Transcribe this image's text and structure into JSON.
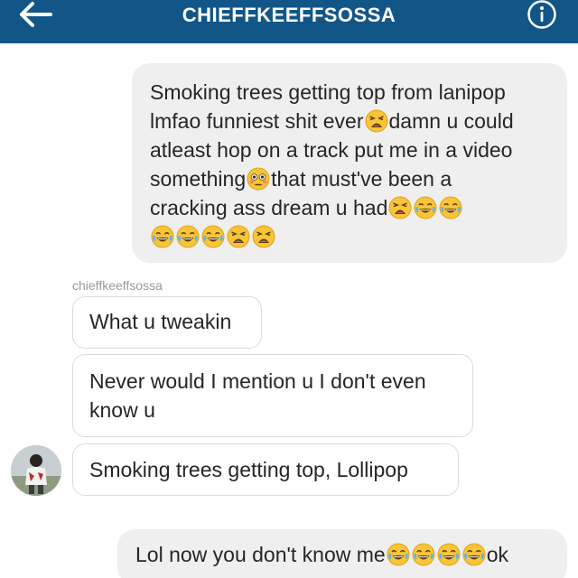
{
  "header": {
    "title": "CHIEFFKEEFFSOSSA",
    "back_icon": "arrow-left-icon",
    "info_icon": "info-icon",
    "background": "#125688"
  },
  "thread": {
    "sender_name": "chieffkeeffsossa",
    "messages": [
      {
        "direction": "outgoing",
        "lines": [
          [
            {
              "t": "text",
              "v": "Smoking trees getting top from lanipop"
            }
          ],
          [
            {
              "t": "text",
              "v": "lmfao funniest shit ever"
            },
            {
              "t": "emoji",
              "v": "weary"
            },
            {
              "t": "text",
              "v": "damn u could"
            }
          ],
          [
            {
              "t": "text",
              "v": "atleast hop on a track put me in a video"
            }
          ],
          [
            {
              "t": "text",
              "v": "something"
            },
            {
              "t": "emoji",
              "v": "flushed"
            },
            {
              "t": "text",
              "v": "that must've been a"
            }
          ],
          [
            {
              "t": "text",
              "v": "cracking ass dream u had"
            },
            {
              "t": "emoji",
              "v": "weary"
            },
            {
              "t": "emoji",
              "v": "joy"
            },
            {
              "t": "emoji",
              "v": "joy"
            }
          ],
          [
            {
              "t": "emoji",
              "v": "joy"
            },
            {
              "t": "emoji",
              "v": "joy"
            },
            {
              "t": "emoji",
              "v": "joy"
            },
            {
              "t": "emoji",
              "v": "weary"
            },
            {
              "t": "emoji",
              "v": "weary"
            }
          ]
        ]
      },
      {
        "direction": "incoming",
        "lines": [
          [
            {
              "t": "text",
              "v": "What u tweakin"
            }
          ]
        ]
      },
      {
        "direction": "incoming",
        "lines": [
          [
            {
              "t": "text",
              "v": "Never would I mention u I don't even"
            }
          ],
          [
            {
              "t": "text",
              "v": "know u"
            }
          ]
        ]
      },
      {
        "direction": "incoming",
        "lines": [
          [
            {
              "t": "text",
              "v": "Smoking trees getting top, Lollipop"
            }
          ]
        ]
      },
      {
        "direction": "outgoing",
        "lines": [
          [
            {
              "t": "text",
              "v": "Lol now you don't know me"
            },
            {
              "t": "emoji",
              "v": "joy"
            },
            {
              "t": "emoji",
              "v": "joy"
            },
            {
              "t": "emoji",
              "v": "joy"
            },
            {
              "t": "emoji",
              "v": "joy"
            },
            {
              "t": "text",
              "v": "ok"
            }
          ]
        ]
      }
    ]
  },
  "avatar_icon": "user-avatar"
}
